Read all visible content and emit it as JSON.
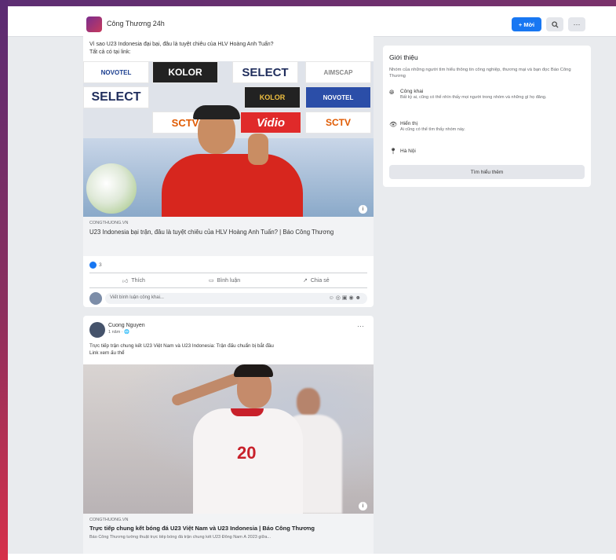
{
  "header": {
    "group_name": "Công Thương 24h",
    "join_label": "+ Mời",
    "search_icon": "search-icon",
    "more_icon": "more-icon"
  },
  "post1": {
    "text_line1": "Vì sao U23 Indonesia đại bại, đâu là tuyệt chiêu của HLV Hoàng Anh Tuấn?",
    "text_line2": "Tất cả có tại link:",
    "board": [
      "NOVOTEL",
      "KOLOR",
      "SELECT",
      "AIMSCAP",
      "SELECT",
      "KOLOR",
      "NOVOTEL",
      "SCTV",
      "Vidio",
      "SCTV"
    ],
    "source": "CONGTHUONG.VN",
    "title": "U23 Indonesia bại trận, đâu là tuyệt chiêu của HLV Hoàng Anh Tuấn? | Báo Công Thương",
    "reaction_count": "3",
    "like_label": "Thích",
    "comment_label": "Bình luận",
    "share_label": "Chia sẻ",
    "comment_placeholder": "Viết bình luận công khai..."
  },
  "post2": {
    "author": "Cuong Nguyen",
    "time": "1 năm · 🌐",
    "text_line1": "Trực tiếp trận chung kết U23 Việt Nam và U23 Indonesia: Trận đấu chuẩn bị bắt đầu",
    "text_line2": "Link xem ấu thể",
    "jersey_number": "20",
    "source": "CONGTHUONG.VN",
    "title": "Trực tiếp chung kết bóng đá U23 Việt Nam và U23 Indonesia | Báo Công Thương",
    "desc": "Báo Công Thương tường thuật trực tiếp bóng đá trận chung kết U23 Đông Nam Á 2023 giữa..."
  },
  "sidebar": {
    "title": "Giới thiệu",
    "desc": "Nhóm của những người tìm hiểu thông tin công nghiệp, thương mại và bạn đọc Báo Công Thương",
    "public_title": "Công khai",
    "public_desc": "Bất kỳ ai, cũng có thể nhìn thấy mọi người trong nhóm và những gì họ đăng.",
    "visible_title": "Hiển thị",
    "visible_desc": "Ai cũng có thể tìm thấy nhóm này.",
    "location": "Hà Nội",
    "learn_more": "Tìm hiểu thêm"
  },
  "colors": {
    "accent": "#1877f2",
    "frame": "#6a2f6e",
    "bg": "#e9ebee"
  }
}
